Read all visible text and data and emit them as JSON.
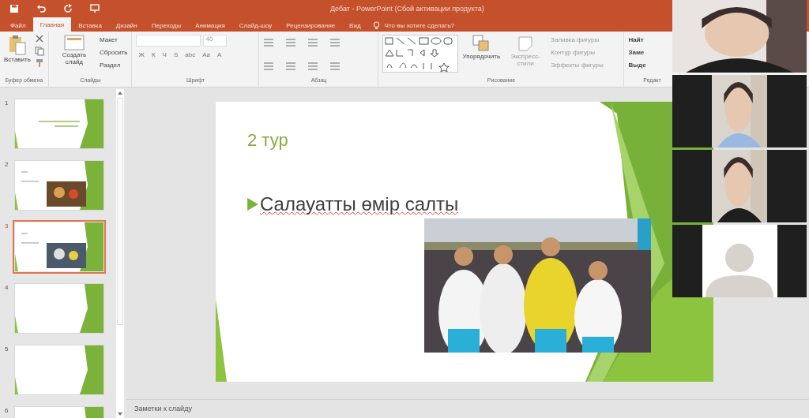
{
  "window": {
    "title": "Дебат - PowerPoint (Сбой активации продукта)"
  },
  "tabs": [
    {
      "label": "Файл",
      "selected": false
    },
    {
      "label": "Главная",
      "selected": true
    },
    {
      "label": "Вставка",
      "selected": false
    },
    {
      "label": "Дизайн",
      "selected": false
    },
    {
      "label": "Переходы",
      "selected": false
    },
    {
      "label": "Анимация",
      "selected": false
    },
    {
      "label": "Слайд-шоу",
      "selected": false
    },
    {
      "label": "Рецензирование",
      "selected": false
    },
    {
      "label": "Вид",
      "selected": false
    }
  ],
  "tell_me": {
    "placeholder": "Что вы хотите сделать?"
  },
  "ribbon": {
    "clipboard": {
      "paste": "Вставить",
      "label": "Буфер обмена"
    },
    "slides": {
      "new_slide": "Создать слайд",
      "layout": "Макет",
      "reset": "Сбросить",
      "section": "Раздел",
      "label": "Слайды"
    },
    "font": {
      "size": "40",
      "buttons": [
        "Ж",
        "К",
        "Ч",
        "S",
        "abc",
        "Аа",
        "А"
      ],
      "label": "Шрифт"
    },
    "paragraph": {
      "label": "Абзац"
    },
    "drawing": {
      "arrange": "Упорядочить",
      "quick_styles": "Экспресс-стили",
      "fill": "Заливка фигуры",
      "outline": "Контур фигуры",
      "effects": "Эффекты фигуры",
      "label": "Рисование"
    },
    "editing": {
      "find": "Найт",
      "replace": "Заме",
      "select": "Выде",
      "label": "Редакт"
    }
  },
  "thumbnails": [
    {
      "number": "1",
      "selected": false,
      "kind": "title"
    },
    {
      "number": "2",
      "selected": false,
      "kind": "picture"
    },
    {
      "number": "3",
      "selected": true,
      "kind": "picture"
    },
    {
      "number": "4",
      "selected": false,
      "kind": "blank"
    },
    {
      "number": "5",
      "selected": false,
      "kind": "blank"
    },
    {
      "number": "6",
      "selected": false,
      "kind": "blank"
    }
  ],
  "slide": {
    "title": "2 тур",
    "bullet": "Салауатты өмір салты"
  },
  "notes": {
    "placeholder": "Заметки к слайду"
  },
  "video_call": {
    "tiles": [
      {
        "kind": "camera"
      },
      {
        "kind": "camera"
      },
      {
        "kind": "camera"
      },
      {
        "kind": "avatar"
      }
    ]
  }
}
